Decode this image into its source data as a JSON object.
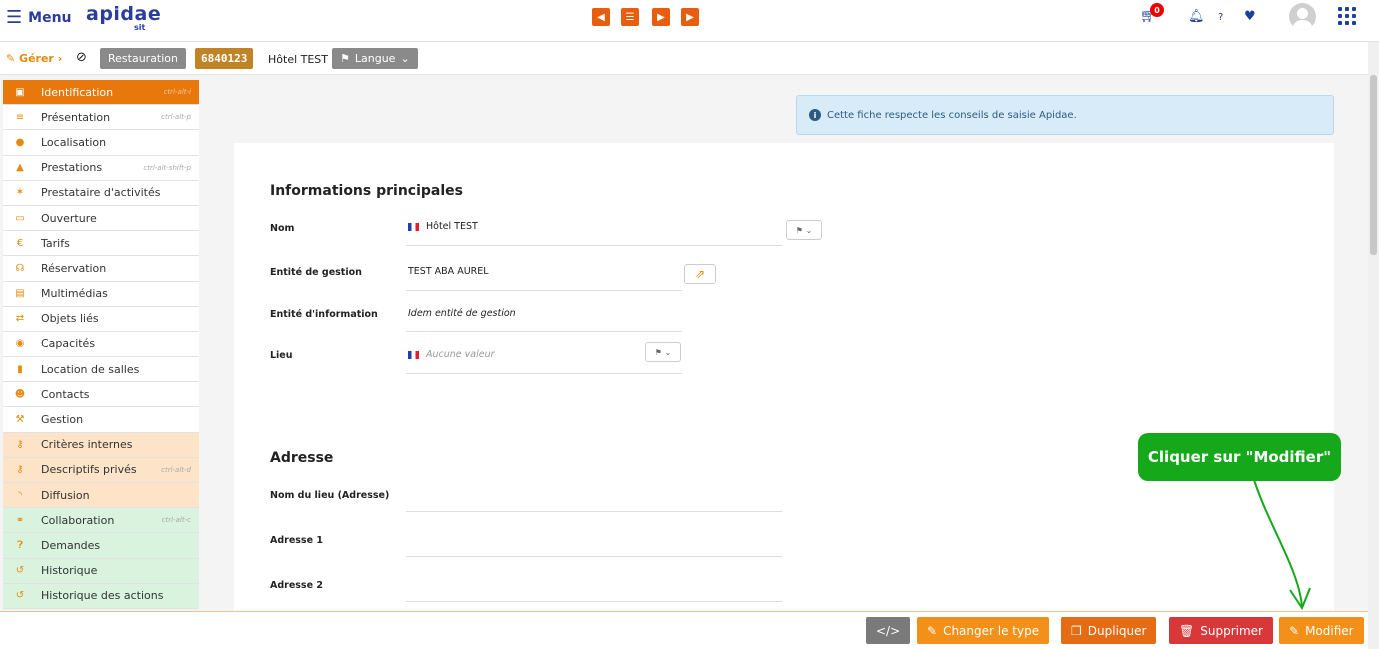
{
  "topbar": {
    "menu_label": "Menu",
    "logo": "apidae",
    "logo_sub": "sit",
    "cart_count": "0",
    "help_label": "?"
  },
  "subbar": {
    "gerer_label": "Gérer",
    "category_tag": "Restauration",
    "id_tag": "6840123",
    "object_name": "Hôtel TEST",
    "language_button": "Langue"
  },
  "sidebar": {
    "items": [
      {
        "label": "Identification",
        "shortcut": "ctrl-alt-i",
        "icon": "id-card-icon"
      },
      {
        "label": "Présentation",
        "shortcut": "ctrl-alt-p",
        "icon": "list-icon"
      },
      {
        "label": "Localisation",
        "shortcut": "",
        "icon": "map-marker-icon"
      },
      {
        "label": "Prestations",
        "shortcut": "ctrl-alt-shift-p",
        "icon": "service-bell-icon"
      },
      {
        "label": "Prestataire d'activités",
        "shortcut": "",
        "icon": "person-running-icon"
      },
      {
        "label": "Ouverture",
        "shortcut": "",
        "icon": "calendar-icon"
      },
      {
        "label": "Tarifs",
        "shortcut": "",
        "icon": "euro-icon"
      },
      {
        "label": "Réservation",
        "shortcut": "",
        "icon": "headset-icon"
      },
      {
        "label": "Multimédias",
        "shortcut": "",
        "icon": "images-icon"
      },
      {
        "label": "Objets liés",
        "shortcut": "",
        "icon": "exchange-icon"
      },
      {
        "label": "Capacités",
        "shortcut": "",
        "icon": "dashboard-icon"
      },
      {
        "label": "Location de salles",
        "shortcut": "",
        "icon": "bookmark-icon"
      },
      {
        "label": "Contacts",
        "shortcut": "",
        "icon": "users-icon"
      },
      {
        "label": "Gestion",
        "shortcut": "",
        "icon": "wrench-icon"
      },
      {
        "label": "Critères internes",
        "shortcut": "",
        "icon": "key-icon"
      },
      {
        "label": "Descriptifs privés",
        "shortcut": "ctrl-alt-d",
        "icon": "key-icon"
      },
      {
        "label": "Diffusion",
        "shortcut": "",
        "icon": "rss-icon"
      },
      {
        "label": "Collaboration",
        "shortcut": "ctrl-alt-c",
        "icon": "handshake-icon"
      },
      {
        "label": "Demandes",
        "shortcut": "",
        "icon": "question-circle-icon"
      },
      {
        "label": "Historique",
        "shortcut": "",
        "icon": "history-icon"
      },
      {
        "label": "Historique des actions",
        "shortcut": "",
        "icon": "history-icon"
      }
    ]
  },
  "notice": {
    "text": "Cette fiche respecte les conseils de saisie Apidae."
  },
  "main": {
    "section_info": "Informations principales",
    "nom_label": "Nom",
    "nom_value": "Hôtel TEST",
    "entite_gestion_label": "Entité de gestion",
    "entite_gestion_value": "TEST ABA AUREL",
    "entite_info_label": "Entité d'information",
    "entite_info_value": "Idem entité de gestion",
    "lieu_label": "Lieu",
    "lieu_placeholder": "Aucune valeur",
    "section_adresse": "Adresse",
    "nom_lieu_label": "Nom du lieu (Adresse)",
    "adresse1_label": "Adresse 1",
    "adresse2_label": "Adresse 2"
  },
  "callout": {
    "text": "Cliquer sur \"Modifier\""
  },
  "bottombar": {
    "code_label": "</>",
    "change_type_label": "Changer le type",
    "duplicate_label": "Dupliquer",
    "delete_label": "Supprimer",
    "edit_label": "Modifier"
  },
  "colors": {
    "accent": "#e8780c",
    "brand": "#2a3d9c",
    "callout": "#15a81b",
    "danger": "#d9383a"
  }
}
